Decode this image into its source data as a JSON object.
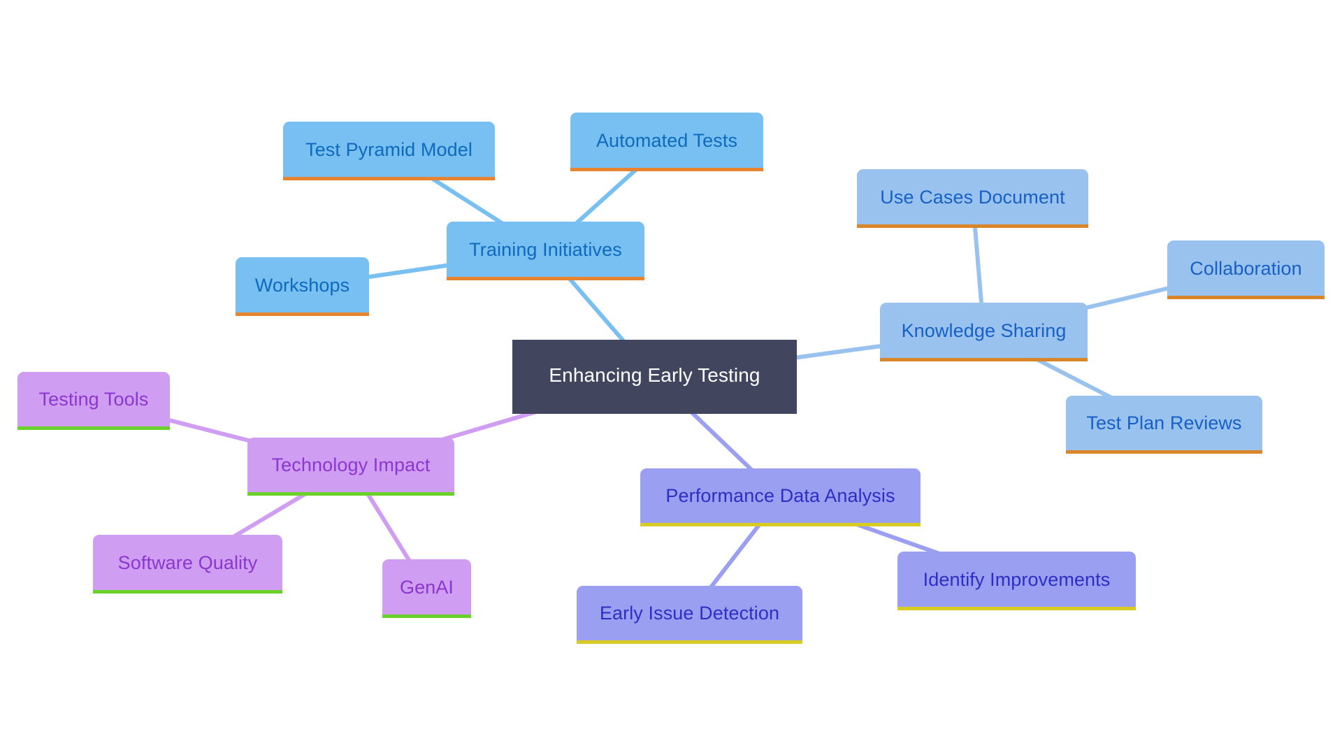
{
  "diagram": {
    "type": "mindmap",
    "root": {
      "id": "root",
      "label": "Enhancing Early Testing",
      "bg": "#41465e",
      "text": "#ffffff"
    },
    "branches": [
      {
        "id": "training",
        "label": "Training Initiatives",
        "bg": "#78bff2",
        "text": "#0e6abd",
        "accent": "#e88430",
        "edge": "#78bff2",
        "children": [
          {
            "id": "test-pyramid",
            "label": "Test Pyramid Model"
          },
          {
            "id": "automated-tests",
            "label": "Automated Tests"
          },
          {
            "id": "workshops",
            "label": "Workshops"
          }
        ]
      },
      {
        "id": "knowledge",
        "label": "Knowledge Sharing",
        "bg": "#9ac2ef",
        "text": "#1660c6",
        "accent": "#d9852a",
        "edge": "#9ac2ef",
        "children": [
          {
            "id": "use-cases",
            "label": "Use Cases Document"
          },
          {
            "id": "collaboration",
            "label": "Collaboration"
          },
          {
            "id": "test-plan-reviews",
            "label": "Test Plan Reviews"
          }
        ]
      },
      {
        "id": "technology",
        "label": "Technology Impact",
        "bg": "#cf9ef2",
        "text": "#8c36cf",
        "accent": "#6ad12a",
        "edge": "#cf9ef2",
        "children": [
          {
            "id": "testing-tools",
            "label": "Testing Tools"
          },
          {
            "id": "software-quality",
            "label": "Software Quality"
          },
          {
            "id": "genai",
            "label": "GenAI"
          }
        ]
      },
      {
        "id": "performance",
        "label": "Performance Data Analysis",
        "bg": "#9a9ff2",
        "text": "#2d2fc4",
        "accent": "#d8cc22",
        "edge": "#9a9ff2",
        "children": [
          {
            "id": "early-issue",
            "label": "Early Issue Detection"
          },
          {
            "id": "identify-improvements",
            "label": "Identify Improvements"
          }
        ]
      }
    ]
  }
}
